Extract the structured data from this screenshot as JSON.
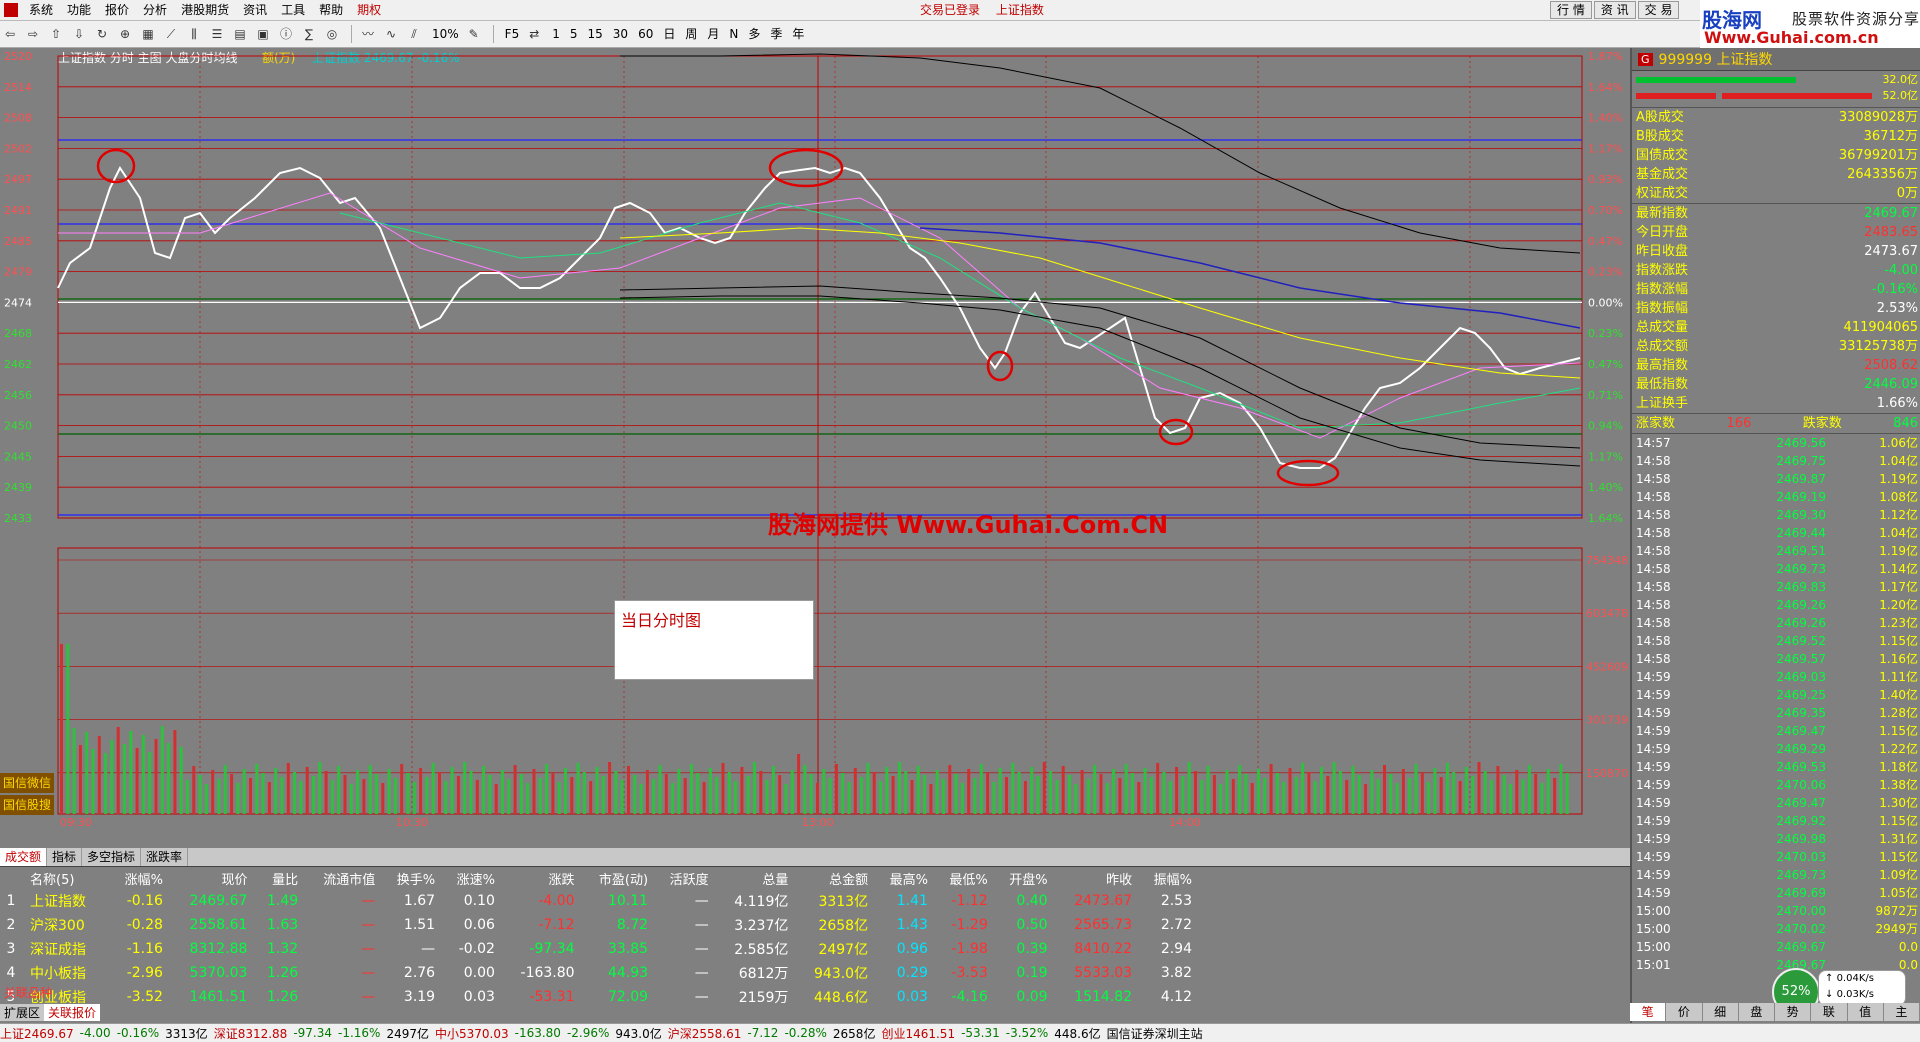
{
  "menu": [
    "系统",
    "功能",
    "报价",
    "分析",
    "港股期货",
    "资讯",
    "工具",
    "帮助",
    "期权"
  ],
  "title_status": [
    "交易已登录",
    "上证指数"
  ],
  "right_buttons": [
    "行 情",
    "资 讯",
    "交 易"
  ],
  "logo": {
    "name": "股海网",
    "slogan": "股票软件资源分享",
    "url": "Www.Guhai.com.cn"
  },
  "toolbar": {
    "periods": [
      "1",
      "5",
      "15",
      "30",
      "60",
      "日",
      "周",
      "月",
      "N",
      "多",
      "季",
      "年"
    ],
    "f5": "F5",
    "pct": "10%"
  },
  "chart": {
    "header": "上证指数  分时 主图 大盘分时均线",
    "header_tag": "额(万)",
    "header_val": "上证指数 2469.67 -0.16%",
    "left_ticks": [
      "2520",
      "2514",
      "2508",
      "2502",
      "2497",
      "2491",
      "2485",
      "2479",
      "2474",
      "2468",
      "2462",
      "2456",
      "2450",
      "2445",
      "2439",
      "2433"
    ],
    "right_ticks": [
      "1.87%",
      "1.64%",
      "1.40%",
      "1.17%",
      "0.93%",
      "0.70%",
      "0.47%",
      "0.23%",
      "0.00%",
      "0.23%",
      "0.47%",
      "0.71%",
      "0.94%",
      "1.17%",
      "1.40%",
      "1.64%"
    ],
    "vol_ticks": [
      "754348",
      "603478",
      "452609",
      "301739",
      "150870"
    ],
    "time_labels": [
      "09:30",
      "10:30",
      "13:00",
      "14:00"
    ],
    "side_labels": [
      "国信微信",
      "国信股搜"
    ],
    "watermark": "股海网提供 Www.Guhai.Com.CN",
    "note": "当日分时图"
  },
  "panel": {
    "badge": "G",
    "code": "999999 上证指数",
    "bar1": "32.0亿",
    "bar2": "52.0亿",
    "rows1": [
      {
        "k": "A股成交",
        "v": "33089028万",
        "c": "y"
      },
      {
        "k": "B股成交",
        "v": "36712万",
        "c": "y"
      },
      {
        "k": "国债成交",
        "v": "36799201万",
        "c": "y"
      },
      {
        "k": "基金成交",
        "v": "2643356万",
        "c": "y"
      },
      {
        "k": "权证成交",
        "v": "0万",
        "c": "y"
      }
    ],
    "rows2": [
      {
        "k": "最新指数",
        "v": "2469.67",
        "c": "grn"
      },
      {
        "k": "今日开盘",
        "v": "2483.65",
        "c": "red"
      },
      {
        "k": "昨日收盘",
        "v": "2473.67",
        "c": "wht"
      },
      {
        "k": "指数涨跌",
        "v": "-4.00",
        "c": "grn"
      },
      {
        "k": "指数涨幅",
        "v": "-0.16%",
        "c": "grn"
      },
      {
        "k": "指数振幅",
        "v": "2.53%",
        "c": "wht"
      },
      {
        "k": "总成交量",
        "v": "411904065",
        "c": "y"
      },
      {
        "k": "总成交额",
        "v": "33125738万",
        "c": "y"
      },
      {
        "k": "最高指数",
        "v": "2508.62",
        "c": "red"
      },
      {
        "k": "最低指数",
        "v": "2446.09",
        "c": "grn"
      },
      {
        "k": "上证换手",
        "v": "1.66%",
        "c": "wht"
      }
    ],
    "updown": {
      "up_label": "涨家数",
      "up": "166",
      "down_label": "跌家数",
      "down": "846"
    },
    "ticks": [
      [
        "14:57",
        "2469.56",
        "1.06亿"
      ],
      [
        "14:58",
        "2469.75",
        "1.04亿"
      ],
      [
        "14:58",
        "2469.87",
        "1.19亿"
      ],
      [
        "14:58",
        "2469.19",
        "1.08亿"
      ],
      [
        "14:58",
        "2469.30",
        "1.12亿"
      ],
      [
        "14:58",
        "2469.44",
        "1.04亿"
      ],
      [
        "14:58",
        "2469.51",
        "1.19亿"
      ],
      [
        "14:58",
        "2469.73",
        "1.14亿"
      ],
      [
        "14:58",
        "2469.83",
        "1.17亿"
      ],
      [
        "14:58",
        "2469.26",
        "1.20亿"
      ],
      [
        "14:58",
        "2469.26",
        "1.23亿"
      ],
      [
        "14:58",
        "2469.52",
        "1.15亿"
      ],
      [
        "14:58",
        "2469.57",
        "1.16亿"
      ],
      [
        "14:59",
        "2469.03",
        "1.11亿"
      ],
      [
        "14:59",
        "2469.25",
        "1.40亿"
      ],
      [
        "14:59",
        "2469.35",
        "1.28亿"
      ],
      [
        "14:59",
        "2469.47",
        "1.15亿"
      ],
      [
        "14:59",
        "2469.29",
        "1.22亿"
      ],
      [
        "14:59",
        "2469.53",
        "1.18亿"
      ],
      [
        "14:59",
        "2470.06",
        "1.38亿"
      ],
      [
        "14:59",
        "2469.47",
        "1.30亿"
      ],
      [
        "14:59",
        "2469.92",
        "1.15亿"
      ],
      [
        "14:59",
        "2469.98",
        "1.31亿"
      ],
      [
        "14:59",
        "2470.03",
        "1.15亿"
      ],
      [
        "14:59",
        "2469.73",
        "1.09亿"
      ],
      [
        "14:59",
        "2469.69",
        "1.05亿"
      ],
      [
        "15:00",
        "2470.00",
        "9872万"
      ],
      [
        "15:00",
        "2470.02",
        "2949万"
      ],
      [
        "15:00",
        "2469.67",
        "0.0"
      ],
      [
        "15:01",
        "2469.67",
        "0.0"
      ]
    ],
    "tabs": [
      "笔",
      "价",
      "细",
      "盘",
      "势",
      "联",
      "值",
      "主"
    ],
    "ring": "52%",
    "speed_up": "0.04K/s",
    "speed_down": "0.03K/s"
  },
  "bottom": {
    "tabs": [
      "成交额",
      "指标",
      "多空指标",
      "涨跌率"
    ],
    "headers": [
      "名称(5)",
      "涨幅%",
      "现价",
      "量比",
      "流通市值",
      "换手%",
      "涨速%",
      "涨跌",
      "市盈(动)",
      "活跃度",
      "总量",
      "总金额",
      "最高%",
      "最低%",
      "开盘%",
      "昨收",
      "振幅%"
    ],
    "rows": [
      [
        "1",
        "上证指数",
        "-0.16",
        "2469.67",
        "1.49",
        "—",
        "1.67",
        "0.10",
        "-4.00",
        "10.11",
        "—",
        "4.119亿",
        "3313亿",
        "1.41",
        "-1.12",
        "0.40",
        "2473.67",
        "2.53"
      ],
      [
        "2",
        "沪深300",
        "-0.28",
        "2558.61",
        "1.63",
        "—",
        "1.51",
        "0.06",
        "-7.12",
        "8.72",
        "—",
        "3.237亿",
        "2658亿",
        "1.43",
        "-1.29",
        "0.50",
        "2565.73",
        "2.72"
      ],
      [
        "3",
        "深证成指",
        "-1.16",
        "8312.88",
        "1.32",
        "—",
        "—",
        "-0.02",
        "-97.34",
        "33.85",
        "—",
        "2.585亿",
        "2497亿",
        "0.96",
        "-1.98",
        "0.39",
        "8410.22",
        "2.94"
      ],
      [
        "4",
        "中小板指",
        "-2.96",
        "5370.03",
        "1.26",
        "—",
        "2.76",
        "0.00",
        "-163.80",
        "44.93",
        "—",
        "6812万",
        "943.0亿",
        "0.29",
        "-3.53",
        "0.19",
        "5533.03",
        "3.82"
      ],
      [
        "5",
        "创业板指",
        "-3.52",
        "1461.51",
        "1.26",
        "—",
        "3.19",
        "0.03",
        "-53.31",
        "72.09",
        "—",
        "2159万",
        "448.6亿",
        "0.03",
        "-4.16",
        "0.09",
        "1514.82",
        "4.12"
      ]
    ],
    "row_colors": [
      [
        "",
        "y",
        "g",
        "g",
        "r",
        "",
        "",
        "r",
        "g",
        "",
        "",
        "y",
        "c",
        "r",
        "g",
        "r",
        "",
        ""
      ],
      [
        "",
        "y",
        "g",
        "g",
        "r",
        "",
        "",
        "r",
        "g",
        "",
        "",
        "y",
        "c",
        "r",
        "g",
        "r",
        "",
        ""
      ],
      [
        "",
        "y",
        "g",
        "g",
        "r",
        "",
        "",
        "g",
        "g",
        "",
        "",
        "y",
        "c",
        "r",
        "g",
        "r",
        "",
        ""
      ],
      [
        "",
        "y",
        "g",
        "g",
        "r",
        "",
        "",
        "",
        "g",
        "",
        "",
        "y",
        "c",
        "r",
        "g",
        "r",
        "",
        ""
      ],
      [
        "",
        "y",
        "g",
        "g",
        "r",
        "",
        "",
        "r",
        "g",
        "",
        "",
        "y",
        "c",
        "g",
        "g",
        "g",
        "",
        ""
      ]
    ],
    "corner_tabs": [
      "扩展区",
      "关联报价"
    ],
    "red_label": "关联品种"
  },
  "status": [
    {
      "t": "上证2469.67",
      "c": "sr"
    },
    {
      "t": "-4.00",
      "c": "sg"
    },
    {
      "t": "-0.16%",
      "c": "sg"
    },
    {
      "t": "3313亿",
      "c": ""
    },
    {
      "t": "深证8312.88",
      "c": "sr"
    },
    {
      "t": "-97.34",
      "c": "sg"
    },
    {
      "t": "-1.16%",
      "c": "sg"
    },
    {
      "t": "2497亿",
      "c": ""
    },
    {
      "t": "中小5370.03",
      "c": "sr"
    },
    {
      "t": "-163.80",
      "c": "sg"
    },
    {
      "t": "-2.96%",
      "c": "sg"
    },
    {
      "t": "943.0亿",
      "c": ""
    },
    {
      "t": "沪深2558.61",
      "c": "sr"
    },
    {
      "t": "-7.12",
      "c": "sg"
    },
    {
      "t": "-0.28%",
      "c": "sg"
    },
    {
      "t": "2658亿",
      "c": ""
    },
    {
      "t": "创业1461.51",
      "c": "sr"
    },
    {
      "t": "-53.31",
      "c": "sg"
    },
    {
      "t": "-3.52%",
      "c": "sg"
    },
    {
      "t": "448.6亿",
      "c": ""
    },
    {
      "t": "国信证券深圳主站",
      "c": ""
    }
  ]
}
